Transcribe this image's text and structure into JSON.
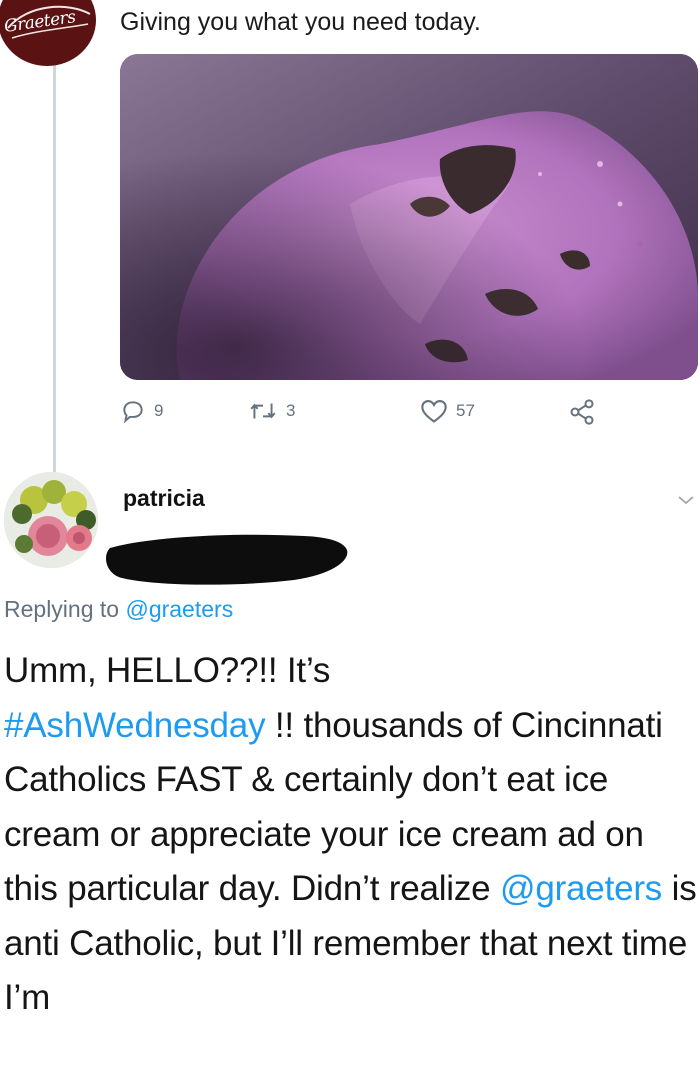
{
  "tweet": {
    "brand_logo_text": "Graeters",
    "text": "Giving you what you need today.",
    "image_alt_icon": "ice-cream-photo",
    "actions": {
      "replies": "9",
      "retweets": "3",
      "likes": "57"
    }
  },
  "reply": {
    "display_name": "patricia",
    "replying_to_label": "Replying to",
    "replying_to_handle": "@graeters",
    "text_line1": "Umm, HELLO??!!  It’s",
    "hashtag": "#AshWednesday",
    "text_after_hashtag": " !! thousands of Cincinnati Catholics FAST & certainly don’t eat ice cream or appreciate your ice cream ad on this particular day. Didn’t realize ",
    "mention": "@graeters",
    "text_end": " is anti Catholic, but I’ll remember that next time I’m"
  },
  "colors": {
    "link": "#1d9bf0",
    "muted": "#65727e",
    "brand_avatar": "#5a1212"
  }
}
